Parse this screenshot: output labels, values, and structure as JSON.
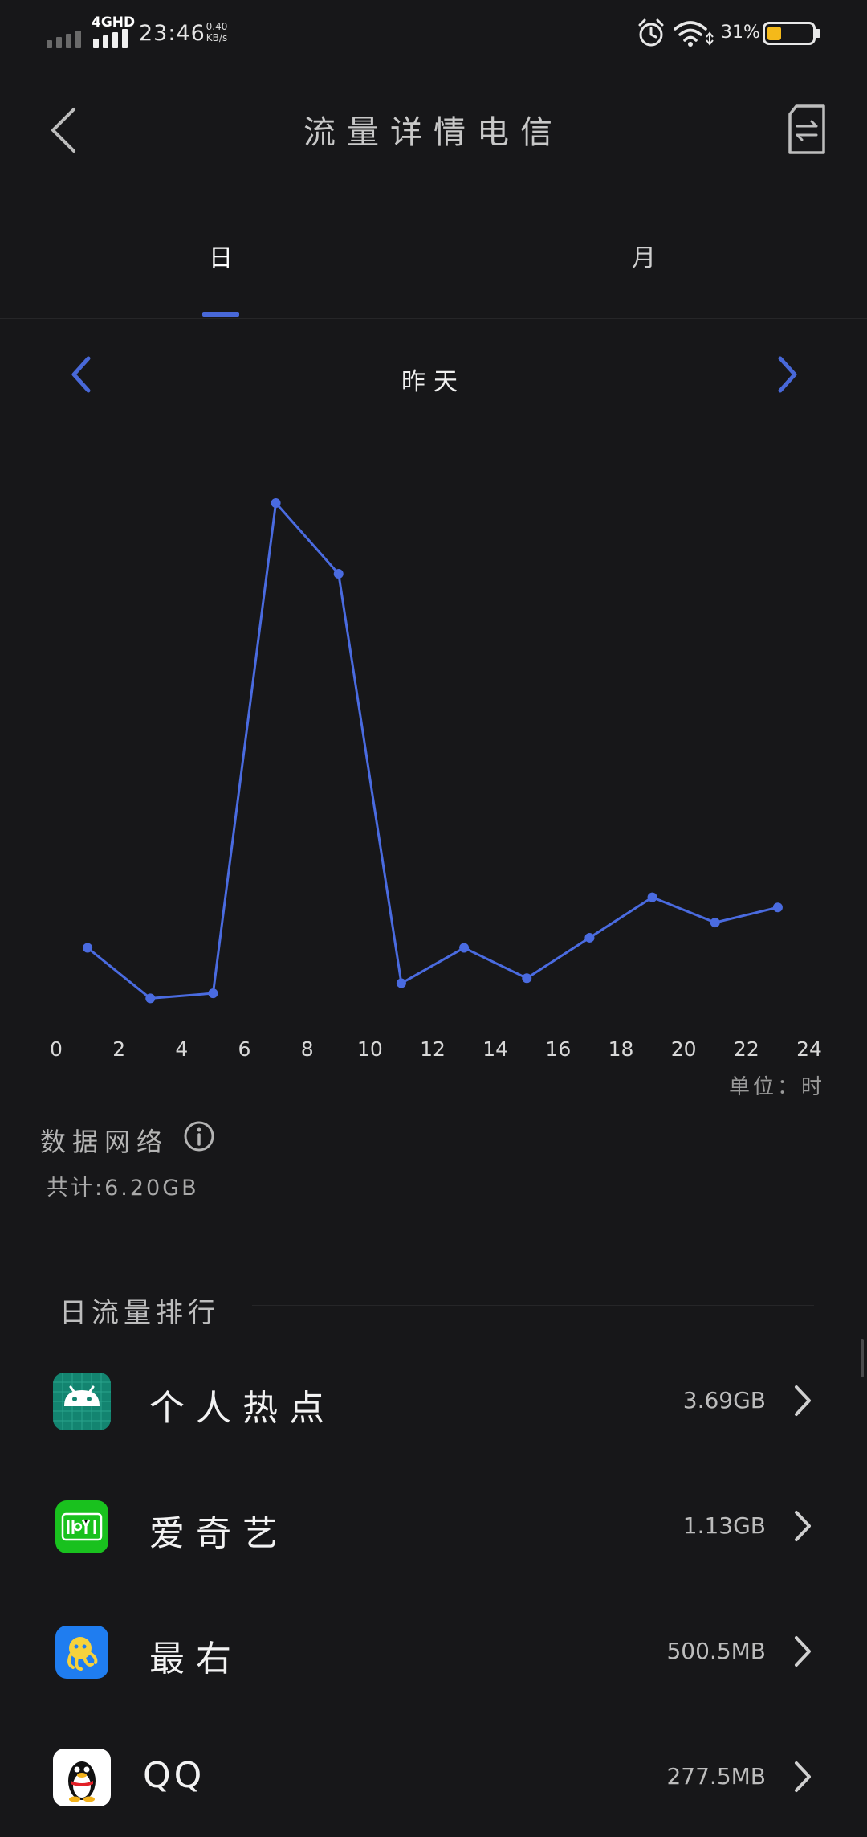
{
  "status_bar": {
    "network_type": "4GHD",
    "time": "23:46",
    "speed_value": "0.40",
    "speed_unit": "KB/s",
    "battery_percent": "31%",
    "battery_level": 0.31,
    "battery_color": "#f4b91a"
  },
  "header": {
    "title": "流量详情电信",
    "back_icon": "chevron-left-icon",
    "sim_switch_icon": "sim-switch-icon"
  },
  "tabs": [
    {
      "label": "日",
      "selected": true
    },
    {
      "label": "月",
      "selected": false
    }
  ],
  "date_nav": {
    "label": "昨天",
    "prev_icon": "chevron-left-icon",
    "next_icon": "chevron-right-icon"
  },
  "chart_data": {
    "type": "line",
    "x": [
      1,
      3,
      5,
      7,
      9,
      11,
      13,
      15,
      17,
      19,
      21,
      23
    ],
    "y": [
      0.12,
      0.02,
      0.03,
      1.0,
      0.86,
      0.05,
      0.12,
      0.06,
      0.14,
      0.22,
      0.17,
      0.2
    ],
    "x_ticks": [
      "0",
      "2",
      "4",
      "6",
      "8",
      "10",
      "12",
      "14",
      "16",
      "18",
      "20",
      "22",
      "24"
    ],
    "xlim": [
      0,
      24
    ],
    "ylim": [
      0,
      1
    ],
    "grid": false,
    "color": "#4a6be0",
    "unit_label": "单位：时"
  },
  "summary": {
    "network_label": "数据网络",
    "total_label": "共计:6.20GB",
    "info_icon": "info-icon"
  },
  "ranking": {
    "title": "日流量排行",
    "apps": [
      {
        "name": "个人热点",
        "usage": "3.69GB",
        "icon": "android-icon",
        "color": "#138470"
      },
      {
        "name": "爱奇艺",
        "usage": "1.13GB",
        "icon": "iqiyi-icon",
        "color": "#19c11e"
      },
      {
        "name": "最右",
        "usage": "500.5MB",
        "icon": "zuiyou-icon",
        "color": "#1f7df0"
      },
      {
        "name": "QQ",
        "usage": "277.5MB",
        "icon": "qq-penguin-icon",
        "color": "#ffffff"
      }
    ]
  },
  "colors": {
    "background": "#171719",
    "accent": "#4868d8"
  }
}
